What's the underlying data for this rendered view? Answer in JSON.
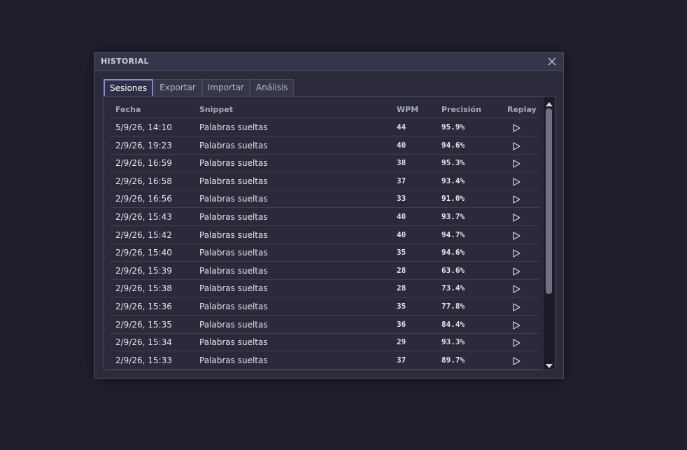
{
  "dialog": {
    "title": "HISTORIAL"
  },
  "tabs": [
    {
      "label": "Sesiones",
      "active": true
    },
    {
      "label": "Exportar",
      "active": false
    },
    {
      "label": "Importar",
      "active": false
    },
    {
      "label": "Análisis",
      "active": false
    }
  ],
  "table": {
    "headers": {
      "fecha": "Fecha",
      "snippet": "Snippet",
      "wpm": "WPM",
      "precision": "Precisión",
      "replay": "Replay"
    },
    "rows": [
      {
        "fecha": "5/9/26, 14:10",
        "snippet": "Palabras sueltas",
        "wpm": "44",
        "precision": "95.9%"
      },
      {
        "fecha": "2/9/26, 19:23",
        "snippet": "Palabras sueltas",
        "wpm": "40",
        "precision": "94.6%"
      },
      {
        "fecha": "2/9/26, 16:59",
        "snippet": "Palabras sueltas",
        "wpm": "38",
        "precision": "95.3%"
      },
      {
        "fecha": "2/9/26, 16:58",
        "snippet": "Palabras sueltas",
        "wpm": "37",
        "precision": "93.4%"
      },
      {
        "fecha": "2/9/26, 16:56",
        "snippet": "Palabras sueltas",
        "wpm": "33",
        "precision": "91.0%"
      },
      {
        "fecha": "2/9/26, 15:43",
        "snippet": "Palabras sueltas",
        "wpm": "40",
        "precision": "93.7%"
      },
      {
        "fecha": "2/9/26, 15:42",
        "snippet": "Palabras sueltas",
        "wpm": "40",
        "precision": "94.7%"
      },
      {
        "fecha": "2/9/26, 15:40",
        "snippet": "Palabras sueltas",
        "wpm": "35",
        "precision": "94.6%"
      },
      {
        "fecha": "2/9/26, 15:39",
        "snippet": "Palabras sueltas",
        "wpm": "28",
        "precision": "63.6%"
      },
      {
        "fecha": "2/9/26, 15:38",
        "snippet": "Palabras sueltas",
        "wpm": "28",
        "precision": "73.4%"
      },
      {
        "fecha": "2/9/26, 15:36",
        "snippet": "Palabras sueltas",
        "wpm": "35",
        "precision": "77.8%"
      },
      {
        "fecha": "2/9/26, 15:35",
        "snippet": "Palabras sueltas",
        "wpm": "36",
        "precision": "84.4%"
      },
      {
        "fecha": "2/9/26, 15:34",
        "snippet": "Palabras sueltas",
        "wpm": "29",
        "precision": "93.3%"
      },
      {
        "fecha": "2/9/26, 15:33",
        "snippet": "Palabras sueltas",
        "wpm": "37",
        "precision": "89.7%"
      }
    ]
  },
  "icons": {
    "close": "close-icon",
    "replay": "play-icon",
    "scroll_up": "arrow-up-icon",
    "scroll_down": "arrow-down-icon"
  },
  "colors": {
    "accent": "#7c8fd6",
    "background": "#1f1f2e",
    "dialog": "#2b2b3c"
  }
}
